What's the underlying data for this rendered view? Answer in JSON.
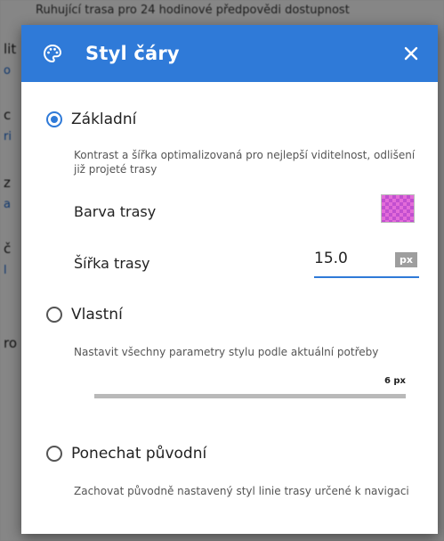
{
  "background": {
    "top_text": "Ruhující trasa pro 24 hodinové předpovědi dostupnost",
    "fragments": [
      "lit",
      "o",
      "c",
      "ri",
      "z",
      "a",
      "č",
      "l",
      "ro"
    ]
  },
  "dialog": {
    "title": "Styl čáry",
    "icons": {
      "palette": "palette-icon",
      "close": "close-icon"
    },
    "colors": {
      "header": "#2f7ad8",
      "accent": "#2f7ad8",
      "route_color": "#e36cd9"
    },
    "options": {
      "basic": {
        "label": "Základní",
        "selected": true,
        "description": "Kontrast a šířka optimalizovaná pro nejlepší viditelnost, odlišení již projeté trasy",
        "color_label": "Barva trasy",
        "width_label": "Šířka trasy",
        "width_value": "15.0",
        "width_unit": "px"
      },
      "custom": {
        "label": "Vlastní",
        "selected": false,
        "description": "Nastavit všechny parametry stylu podle aktuální potřeby",
        "slider_value": "6 px"
      },
      "keep": {
        "label": "Ponechat původní",
        "selected": false,
        "description": "Zachovat původně nastavený styl linie trasy určené k navigaci"
      }
    }
  }
}
